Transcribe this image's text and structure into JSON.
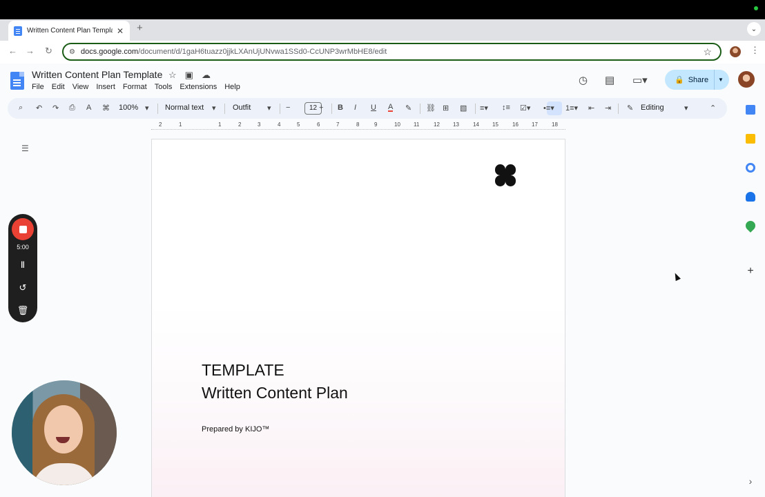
{
  "browser": {
    "tab_title": "Written Content Plan Template",
    "tab_close": "✕",
    "new_tab": "+",
    "url_host": "docs.google.com",
    "url_path": "/document/d/1gaH6tuazz0jjkLXAnUjUNvwa1SSd0-CcUNP3wrMbHE8/edit"
  },
  "docs": {
    "title": "Written Content Plan Template",
    "menu": [
      "File",
      "Edit",
      "View",
      "Insert",
      "Format",
      "Tools",
      "Extensions",
      "Help"
    ],
    "share_label": "Share",
    "toolbar": {
      "zoom": "100%",
      "style": "Normal text",
      "font": "Outfit",
      "font_size": "12",
      "mode": "Editing"
    },
    "ruler_labels": [
      "2",
      "1",
      "1",
      "2",
      "3",
      "4",
      "5",
      "6",
      "7",
      "8",
      "9",
      "10",
      "11",
      "12",
      "13",
      "14",
      "15",
      "16",
      "17",
      "18"
    ]
  },
  "recorder": {
    "time": "5:00"
  },
  "document": {
    "heading": "TEMPLATE",
    "subtitle": "Written Content Plan",
    "prepared": "Prepared by KIJO™"
  },
  "colors": {
    "accent": "#c2e7ff",
    "record": "#e94235",
    "docs_blue": "#4285f4"
  }
}
